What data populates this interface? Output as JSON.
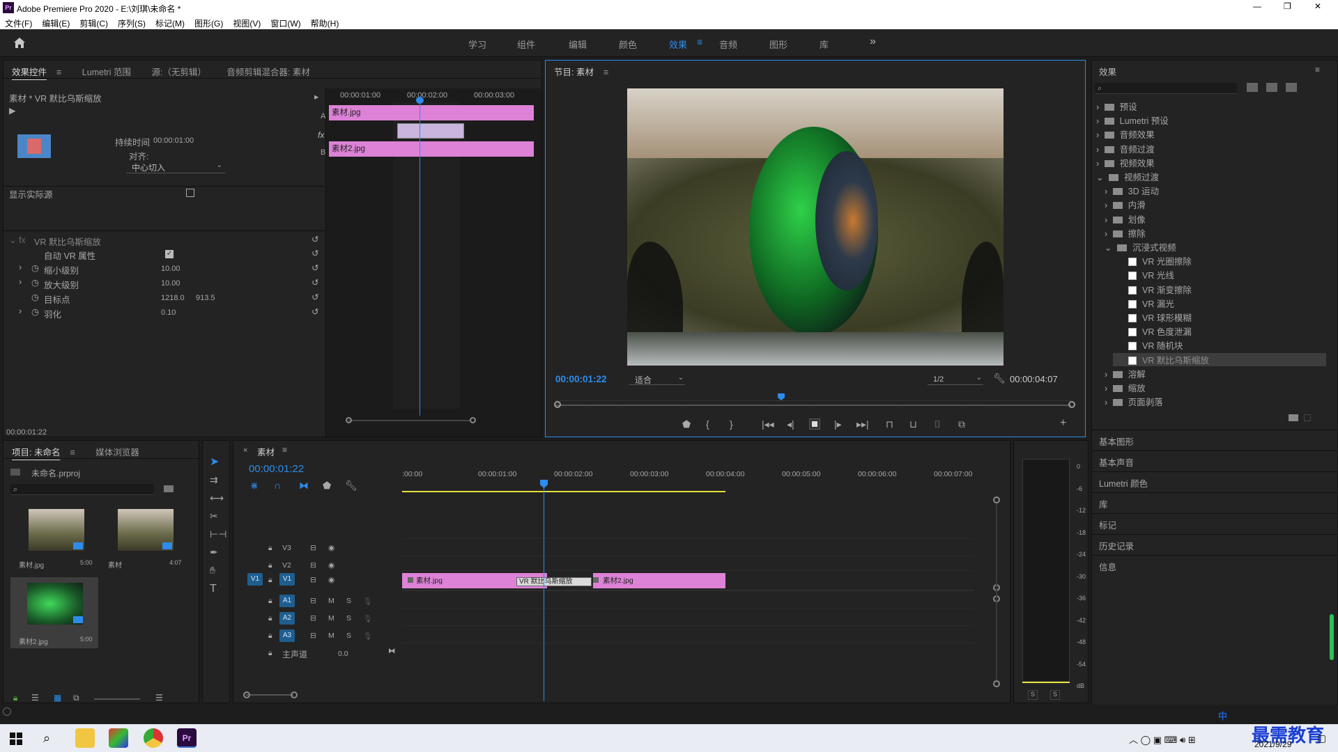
{
  "app": {
    "title": "Adobe Premiere Pro 2020 - E:\\刘琪\\未命名 *",
    "icon_text": "Pr"
  },
  "window_controls": {
    "minimize": "—",
    "maximize": "❐",
    "close": "✕"
  },
  "menu": [
    "文件(F)",
    "编辑(E)",
    "剪辑(C)",
    "序列(S)",
    "标记(M)",
    "图形(G)",
    "视图(V)",
    "窗口(W)",
    "帮助(H)"
  ],
  "workspaces": {
    "tabs": [
      "学习",
      "组件",
      "编辑",
      "颜色",
      "效果",
      "音频",
      "图形",
      "库"
    ],
    "active": "效果",
    "more": "»"
  },
  "effect_controls": {
    "tabs": [
      "效果控件",
      "Lumetri 范围",
      "源:（无剪辑）",
      "音频剪辑混合器: 素材"
    ],
    "clip_header": "素材 * VR 默比乌斯缩放",
    "timecodes": [
      "00:00:01:00",
      "00:00:02:00",
      "00:00:03:00"
    ],
    "clip_a": "素材.jpg",
    "clip_b": "素材2.jpg",
    "duration_label": "持续时间",
    "duration_value": "00:00:01:00",
    "align_label": "对齐:",
    "align_value": "中心切入",
    "show_source": "显示实际源",
    "effect_name": "VR 默比乌斯缩放",
    "params": [
      {
        "label": "自动 VR 属性",
        "value": ""
      },
      {
        "label": "缩小级别",
        "value": "10.00"
      },
      {
        "label": "放大级别",
        "value": "10.00"
      },
      {
        "label": "目标点",
        "value": "1218.0",
        "value2": "913.5"
      },
      {
        "label": "羽化",
        "value": "0.10"
      }
    ],
    "footer_time": "00:00:01:22"
  },
  "program": {
    "title": "节目: 素材",
    "timecode": "00:00:01:22",
    "fit": "适合",
    "res": "1/2",
    "duration": "00:00:04:07"
  },
  "effects_panel": {
    "title": "效果",
    "tree": [
      {
        "label": "预设",
        "level": 0,
        "type": "folder",
        "open": false
      },
      {
        "label": "Lumetri 预设",
        "level": 0,
        "type": "folder",
        "open": false
      },
      {
        "label": "音频效果",
        "level": 0,
        "type": "folder",
        "open": false
      },
      {
        "label": "音频过渡",
        "level": 0,
        "type": "folder",
        "open": false
      },
      {
        "label": "视频效果",
        "level": 0,
        "type": "folder",
        "open": false
      },
      {
        "label": "视频过渡",
        "level": 0,
        "type": "folder",
        "open": true
      },
      {
        "label": "3D 运动",
        "level": 1,
        "type": "folder",
        "open": false
      },
      {
        "label": "内滑",
        "level": 1,
        "type": "folder",
        "open": false
      },
      {
        "label": "划像",
        "level": 1,
        "type": "folder",
        "open": false
      },
      {
        "label": "擦除",
        "level": 1,
        "type": "folder",
        "open": false
      },
      {
        "label": "沉浸式视频",
        "level": 1,
        "type": "folder",
        "open": true
      },
      {
        "label": "VR 光圈擦除",
        "level": 2,
        "type": "fx"
      },
      {
        "label": "VR 光线",
        "level": 2,
        "type": "fx"
      },
      {
        "label": "VR 渐变擦除",
        "level": 2,
        "type": "fx"
      },
      {
        "label": "VR 漏光",
        "level": 2,
        "type": "fx"
      },
      {
        "label": "VR 球形模糊",
        "level": 2,
        "type": "fx"
      },
      {
        "label": "VR 色度泄漏",
        "level": 2,
        "type": "fx"
      },
      {
        "label": "VR 随机块",
        "level": 2,
        "type": "fx"
      },
      {
        "label": "VR 默比乌斯缩放",
        "level": 2,
        "type": "fx",
        "selected": true
      },
      {
        "label": "溶解",
        "level": 1,
        "type": "folder",
        "open": false
      },
      {
        "label": "缩放",
        "level": 1,
        "type": "folder",
        "open": false
      },
      {
        "label": "页面剥落",
        "level": 1,
        "type": "folder",
        "open": false
      }
    ],
    "sections": [
      "基本图形",
      "基本声音",
      "Lumetri 颜色",
      "库",
      "标记",
      "历史记录",
      "信息"
    ]
  },
  "project": {
    "tabs": [
      "项目: 未命名",
      "媒体浏览器"
    ],
    "file": "未命名.prproj",
    "items": [
      {
        "name": "素材.jpg",
        "dur": "5:00"
      },
      {
        "name": "素材",
        "dur": "4:07"
      },
      {
        "name": "素材2.jpg",
        "dur": "5:00"
      }
    ]
  },
  "timeline": {
    "title": "素材",
    "timecode": "00:00:01:22",
    "ruler": [
      ":00:00",
      "00:00:01:00",
      "00:00:02:00",
      "00:00:03:00",
      "00:00:04:00",
      "00:00:05:00",
      "00:00:06:00",
      "00:00:07:00"
    ],
    "video_tracks": [
      "V3",
      "V2",
      "V1"
    ],
    "audio_tracks": [
      "A1",
      "A2",
      "A3"
    ],
    "source_v1": "V1",
    "master": "主声道",
    "master_value": "0.0",
    "clip1": "素材.jpg",
    "transition": "VR 默比乌斯缩放",
    "clip2": "素材2.jpg",
    "mute": "M",
    "solo": "S"
  },
  "meter": {
    "scale": [
      "0",
      "-6",
      "-12",
      "-18",
      "-24",
      "-30",
      "-36",
      "-42",
      "-48",
      "-54",
      "dB"
    ],
    "solo": [
      "S",
      "S"
    ]
  },
  "taskbar": {
    "time": "",
    "date": "2021/9/29",
    "watermark": "最需教育",
    "ime": "中"
  }
}
